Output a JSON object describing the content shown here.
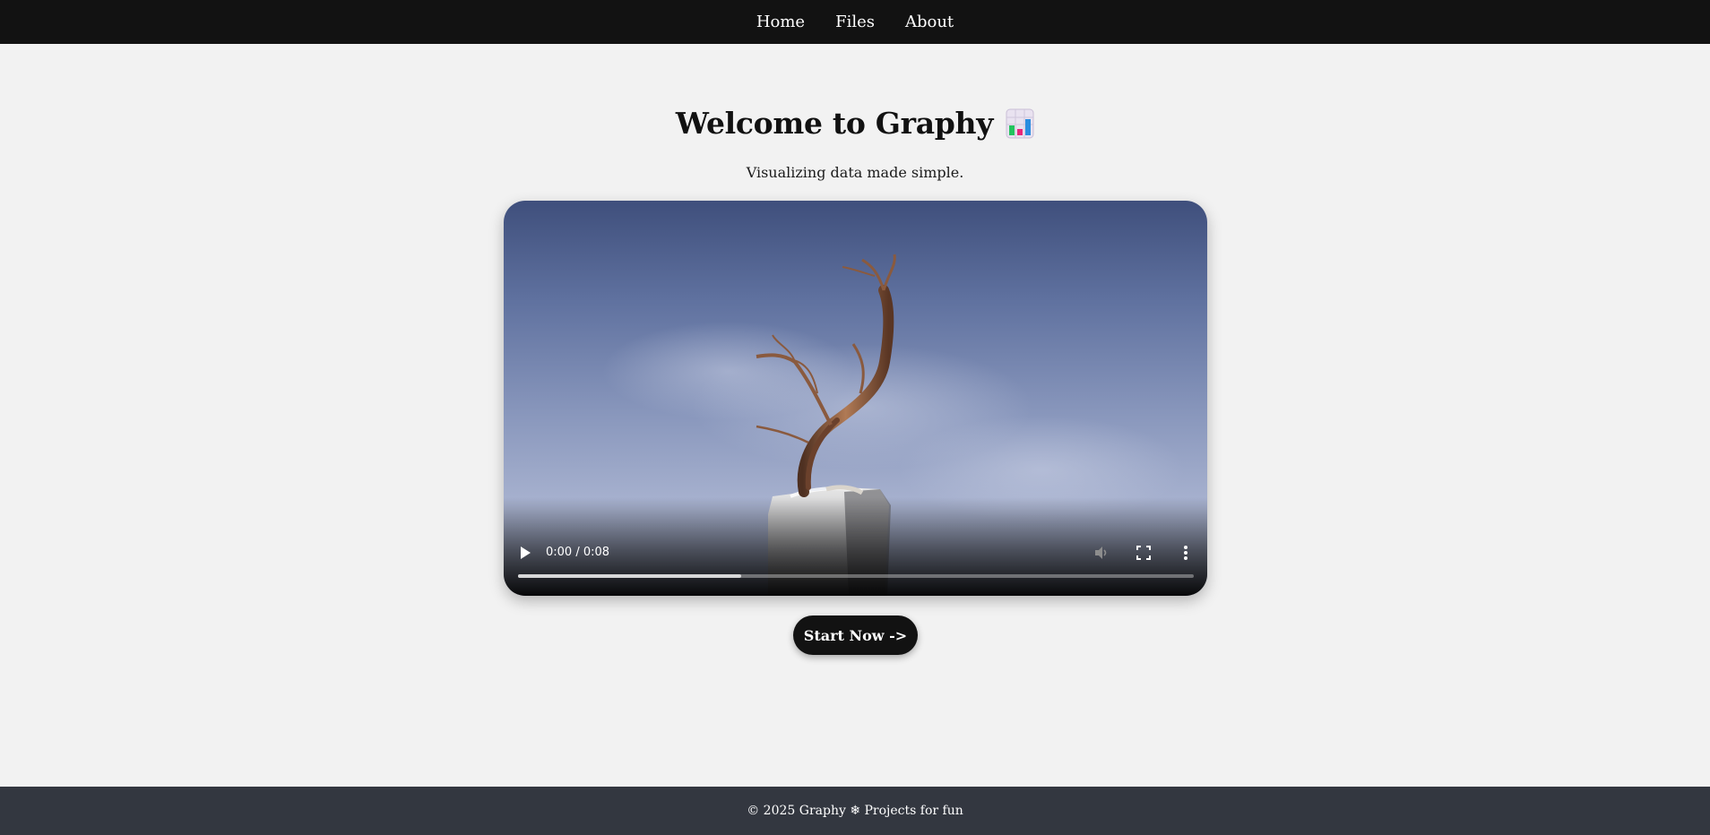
{
  "nav": {
    "items": [
      {
        "label": "Home"
      },
      {
        "label": "Files"
      },
      {
        "label": "About"
      }
    ]
  },
  "hero": {
    "title": "Welcome to Graphy",
    "title_icon": "bar-chart-icon",
    "subtitle": "Visualizing data made simple."
  },
  "video": {
    "time_display": "0:00 / 0:08",
    "progress_buffered_fraction": 0.33,
    "icons": [
      "play-icon",
      "volume-muted-icon",
      "fullscreen-icon",
      "more-vertical-icon"
    ]
  },
  "cta": {
    "label": "Start Now ->"
  },
  "footer": {
    "text": "© 2025 Graphy ❄ Projects for fun"
  }
}
